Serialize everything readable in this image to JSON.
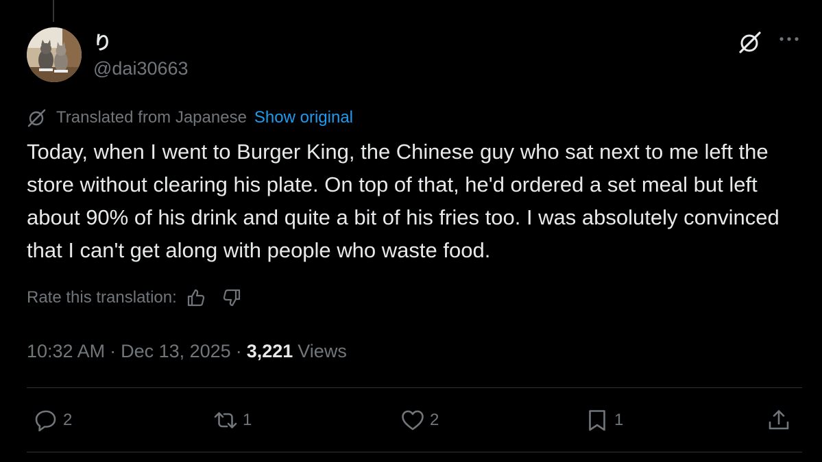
{
  "tweet": {
    "author": {
      "display_name": "り",
      "handle": "@dai30663",
      "avatar": "cats-photo-avatar"
    },
    "header_icons": [
      "grok-icon",
      "more-dots-icon"
    ],
    "translation": {
      "label": "Translated from Japanese",
      "show_original": "Show original",
      "icon": "translate-icon"
    },
    "text": "Today, when I went to Burger King, the Chinese guy who sat next to me left the store without clearing his plate. On top of that, he'd ordered a set meal but left about 90% of his drink and quite a bit of his fries too. I was absolutely convinced that I can't get along with people who waste food.",
    "rate": {
      "label": "Rate this translation:",
      "icons": [
        "thumbs-up-icon",
        "thumbs-down-icon"
      ]
    },
    "meta": {
      "time": "10:32 AM",
      "date": "Dec 13, 2025",
      "separator": "·",
      "views_count": "3,221",
      "views_label": "Views"
    },
    "actions": {
      "reply": "2",
      "repost": "1",
      "like": "2",
      "bookmark": "1"
    }
  },
  "colors": {
    "background": "#000000",
    "text": "#e7e9ea",
    "secondary": "#71767b",
    "link": "#1d9bf0",
    "divider": "#2f3336"
  }
}
